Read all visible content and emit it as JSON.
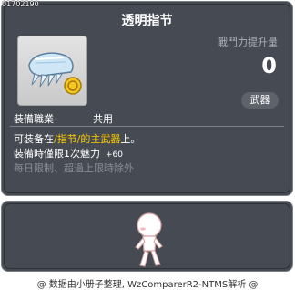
{
  "item": {
    "id": "01702190",
    "name": "透明指节",
    "icon": "transparent-knuckle-icon",
    "job_label": "裝備職業",
    "job_value": "共用",
    "power_label": "戰鬥力提升量",
    "power_value": "0",
    "category": "武器"
  },
  "description": {
    "line1_pre": "可装备在",
    "line1_highlight": "/指节/的主武器",
    "line1_post": "上。",
    "line2_text": "裝備時僅限1次魅力",
    "line2_bonus": "+60",
    "line3": "每日限制、超過上限時除外"
  },
  "preview": {
    "icon": "character-preview-icon"
  },
  "footer": {
    "text": "@ 数据由小册子整理, WzComparerR2-NTMS解析 @"
  },
  "colors": {
    "panel": "#464b53",
    "highlight": "#ffcc00",
    "muted": "#8a8f96"
  }
}
